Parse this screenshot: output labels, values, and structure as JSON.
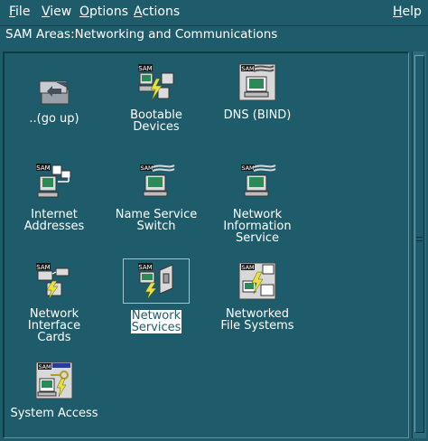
{
  "menubar": {
    "file": "File",
    "view": "View",
    "options": "Options",
    "actions": "Actions",
    "help": "Help"
  },
  "area_title": "SAM Areas:Networking and Communications",
  "badge": "SAM",
  "items": [
    {
      "label": "..(go up)",
      "icon": "folder-up-icon"
    },
    {
      "label": "Bootable\nDevices",
      "icon": "bootable-devices-icon"
    },
    {
      "label": "DNS (BIND)",
      "icon": "dns-icon"
    },
    {
      "label": "Internet\nAddresses",
      "icon": "internet-addresses-icon"
    },
    {
      "label": "Name Service\nSwitch",
      "icon": "name-service-switch-icon"
    },
    {
      "label": "Network\nInformation\nService",
      "icon": "network-information-service-icon"
    },
    {
      "label": "Network\nInterface\nCards",
      "icon": "network-interface-cards-icon"
    },
    {
      "label": "Network\nServices",
      "icon": "network-services-icon",
      "selected": true
    },
    {
      "label": "Networked\nFile Systems",
      "icon": "networked-file-systems-icon"
    },
    {
      "label": "System Access",
      "icon": "system-access-icon"
    }
  ],
  "colors": {
    "background": "#1f5c6b",
    "selection": "#ffffff",
    "icon_frame": "#d8d8d8",
    "screen": "#2b8a55",
    "lightning": "#e8e040"
  }
}
